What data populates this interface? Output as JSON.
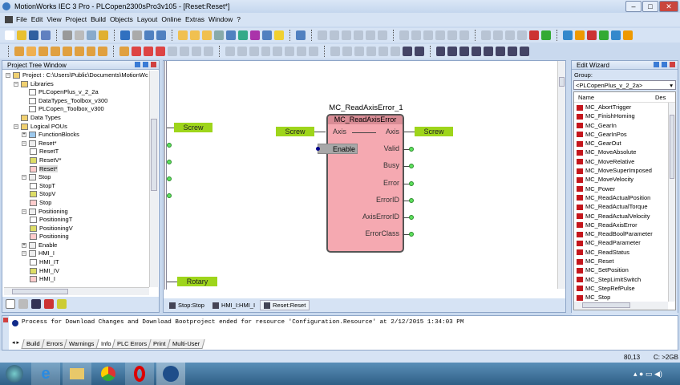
{
  "title": "MotionWorks IEC 3 Pro - PLCopen2300sPro3v105 - [Reset:Reset*]",
  "menu": [
    "File",
    "Edit",
    "View",
    "Project",
    "Build",
    "Objects",
    "Layout",
    "Online",
    "Extras",
    "Window",
    "?"
  ],
  "project_tree": {
    "title": "Project Tree Window",
    "items": [
      {
        "label": "Project : C:\\Users\\Public\\Documents\\MotionWc",
        "lvl": 0,
        "icon": "folder-icon"
      },
      {
        "label": "Libraries",
        "lvl": 1,
        "icon": "folder-icon"
      },
      {
        "label": "PLCopenPlus_v_2_2a",
        "lvl": 2,
        "icon": "library-icon"
      },
      {
        "label": "DataTypes_Toolbox_v300",
        "lvl": 2,
        "icon": "library-icon"
      },
      {
        "label": "PLCopen_Toolbox_v300",
        "lvl": 2,
        "icon": "library-icon"
      },
      {
        "label": "Data Types",
        "lvl": 1,
        "icon": "folder-icon"
      },
      {
        "label": "Logical POUs",
        "lvl": 1,
        "icon": "folder-icon"
      },
      {
        "label": "FunctionBlocks",
        "lvl": 2,
        "icon": "folder-blue-icon"
      },
      {
        "label": "Reset*",
        "lvl": 2,
        "icon": "pou-icon"
      },
      {
        "label": "ResetT",
        "lvl": 3,
        "icon": "info-icon"
      },
      {
        "label": "ResetV*",
        "lvl": 3,
        "icon": "variables-icon"
      },
      {
        "label": "Reset*",
        "lvl": 3,
        "icon": "code-icon",
        "selected": true
      },
      {
        "label": "Stop",
        "lvl": 2,
        "icon": "pou-icon"
      },
      {
        "label": "StopT",
        "lvl": 3,
        "icon": "info-icon"
      },
      {
        "label": "StopV",
        "lvl": 3,
        "icon": "variables-icon"
      },
      {
        "label": "Stop",
        "lvl": 3,
        "icon": "code-icon"
      },
      {
        "label": "Positioning",
        "lvl": 2,
        "icon": "pou-icon"
      },
      {
        "label": "PositioningT",
        "lvl": 3,
        "icon": "info-icon"
      },
      {
        "label": "PositioningV",
        "lvl": 3,
        "icon": "variables-icon"
      },
      {
        "label": "Positioning",
        "lvl": 3,
        "icon": "code-icon"
      },
      {
        "label": "Enable",
        "lvl": 2,
        "icon": "pou-icon"
      },
      {
        "label": "HMI_I",
        "lvl": 2,
        "icon": "pou-icon"
      },
      {
        "label": "HMI_IT",
        "lvl": 3,
        "icon": "info-icon"
      },
      {
        "label": "HMI_IV",
        "lvl": 3,
        "icon": "variables-icon"
      },
      {
        "label": "HMI_I",
        "lvl": 3,
        "icon": "code-icon"
      }
    ]
  },
  "editor": {
    "left_labels": [
      "Screw",
      "Rotary"
    ],
    "block": {
      "instance": "MC_ReadAxisError_1",
      "type": "MC_ReadAxisError",
      "inputs": [
        "Axis",
        "Enable"
      ],
      "outputs": [
        "Axis",
        "Valid",
        "Busy",
        "Error",
        "ErrorID",
        "AxisErrorID",
        "ErrorClass"
      ],
      "in_var": "Screw",
      "out_var": "Screw"
    },
    "tabs": [
      "Stop:Stop",
      "HMI_I:HMI_I",
      "Reset:Reset"
    ]
  },
  "edit_wizard": {
    "title": "Edit Wizard",
    "group_label": "Group:",
    "group_value": "<PLCopenPlus_v_2_2a>",
    "col_name": "Name",
    "col_desc": "Des",
    "items": [
      "MC_AbortTrigger",
      "MC_FinishHoming",
      "MC_GearIn",
      "MC_GearInPos",
      "MC_GearOut",
      "MC_MoveAbsolute",
      "MC_MoveRelative",
      "MC_MoveSuperImposed",
      "MC_MoveVelocity",
      "MC_Power",
      "MC_ReadActualPosition",
      "MC_ReadActualTorque",
      "MC_ReadActualVelocity",
      "MC_ReadAxisError",
      "MC_ReadBoolParameter",
      "MC_ReadParameter",
      "MC_ReadStatus",
      "MC_Reset",
      "MC_SetPosition",
      "MC_StepLimitSwitch",
      "MC_StepRefPulse",
      "MC_Stop"
    ]
  },
  "output": {
    "message": "Process for Download Changes and Download Bootproject ended for resource 'Configuration.Resource' at 2/12/2015 1:34:03 PM",
    "tabs": [
      "Build",
      "Errors",
      "Warnings",
      "Info",
      "PLC Errors",
      "Print",
      "Multi-User"
    ],
    "active_tab": "Info"
  },
  "status": {
    "position": "80,13",
    "disk": "C: >2GB"
  }
}
